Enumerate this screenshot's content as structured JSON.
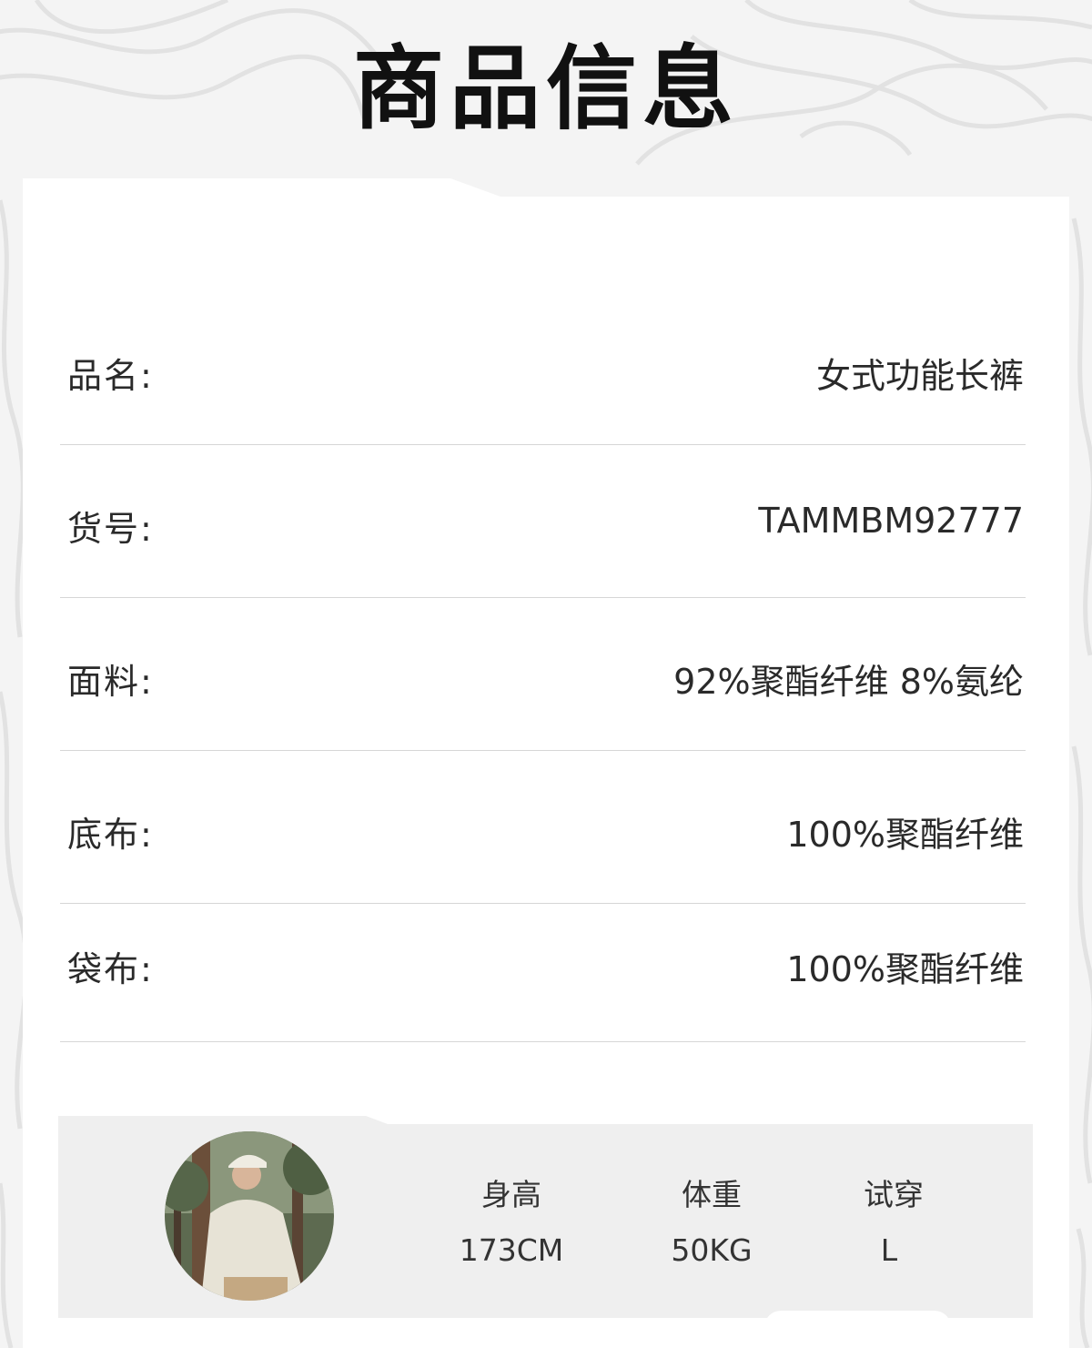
{
  "header": {
    "title": "商品信息"
  },
  "specs": [
    {
      "label": "品名:",
      "value": "女式功能长裤"
    },
    {
      "label": "货号:",
      "value": "TAMMBM92777"
    },
    {
      "label": "面料:",
      "value": "92%聚酯纤维 8%氨纶"
    },
    {
      "label": "底布:",
      "value": "100%聚酯纤维"
    },
    {
      "label": "袋布:",
      "value": "100%聚酯纤维"
    }
  ],
  "model": {
    "photo": "model-photo",
    "stats": [
      {
        "label": "身高",
        "value": "173CM"
      },
      {
        "label": "体重",
        "value": "50KG"
      },
      {
        "label": "试穿",
        "value": "L"
      }
    ]
  },
  "colors": {
    "background": "#f4f4f4",
    "card": "#ffffff",
    "panel": "#efefef",
    "divider": "#d6d6d6",
    "title": "#111111",
    "text": "#2a2a2a"
  }
}
